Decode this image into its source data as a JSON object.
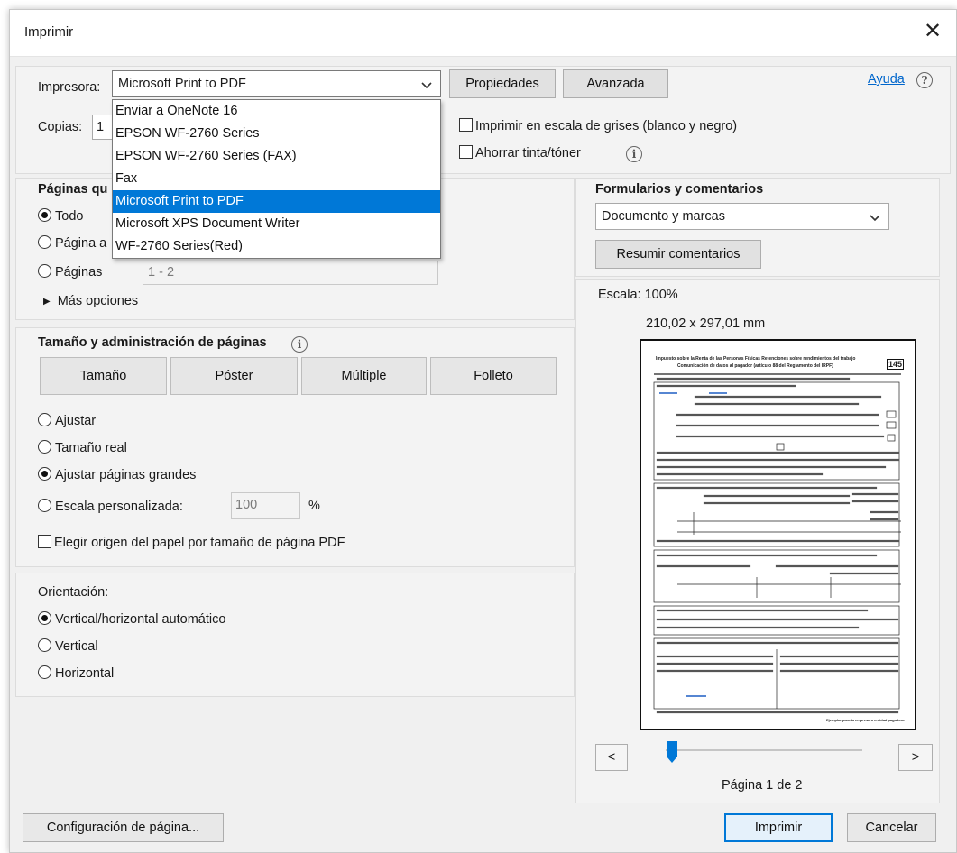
{
  "window": {
    "title": "Imprimir",
    "close_glyph": "✕"
  },
  "printer": {
    "label": "Impresora:",
    "selected": "Microsoft Print to PDF",
    "properties_button": "Propiedades",
    "advanced_button": "Avanzada",
    "help_link": "Ayuda",
    "help_glyph": "?",
    "options": [
      "Enviar a OneNote 16",
      "EPSON WF-2760 Series",
      "EPSON WF-2760 Series (FAX)",
      "Fax",
      "Microsoft Print to PDF",
      "Microsoft XPS Document Writer",
      "WF-2760 Series(Red)"
    ]
  },
  "copies": {
    "label": "Copias:",
    "value": "1"
  },
  "grayscale": {
    "label": "Imprimir en escala de grises (blanco y negro)",
    "checked": false
  },
  "save_ink": {
    "label": "Ahorrar tinta/tóner",
    "checked": false,
    "info_glyph": "i"
  },
  "pages_to_print": {
    "heading_visible": "Páginas qu",
    "all_label": "Todo",
    "current_label_visible": "Página a",
    "pages_label": "Páginas",
    "pages_value": "1 - 2",
    "more_options": "Más opciones",
    "more_glyph": "▶",
    "selected": "all"
  },
  "page_sizing": {
    "heading": "Tamaño y administración de páginas",
    "info_glyph": "i",
    "buttons": [
      "Tamaño",
      "Póster",
      "Múltiple",
      "Folleto"
    ],
    "fit_label": "Ajustar",
    "actual_label": "Tamaño real",
    "shrink_label": "Ajustar páginas grandes",
    "custom_label": "Escala personalizada:",
    "custom_value": "100",
    "percent": "%",
    "paper_source_label": "Elegir origen del papel por tamaño de página PDF",
    "selected": "shrink"
  },
  "orientation": {
    "heading": "Orientación:",
    "auto_label": "Vertical/horizontal automático",
    "portrait_label": "Vertical",
    "landscape_label": "Horizontal",
    "selected": "auto"
  },
  "comments_forms": {
    "heading": "Formularios y comentarios",
    "selected": "Documento y marcas",
    "summarize_button": "Resumir comentarios"
  },
  "preview": {
    "scale": "Escala: 100%",
    "dimensions": "210,02 x 297,01 mm",
    "prev_glyph": "<",
    "next_glyph": ">",
    "page_info": "Página 1 de 2",
    "slider_fraction": 0.0,
    "doc": {
      "title_line1": "Impuesto sobre la Renta de las Personas Físicas   Retenciones sobre rendimientos del trabajo",
      "title_line2": "Comunicación de datos al pagador (artículo 88 del Reglamento del IRPF)",
      "model": "145",
      "footer_note": "Ejemplar para la empresa o entidad pagadora"
    }
  },
  "footer": {
    "page_setup_button": "Configuración de página...",
    "print_button": "Imprimir",
    "cancel_button": "Cancelar"
  },
  "colors": {
    "accent": "#0078d7",
    "link": "#0066cc",
    "slider": "#0078d7"
  }
}
